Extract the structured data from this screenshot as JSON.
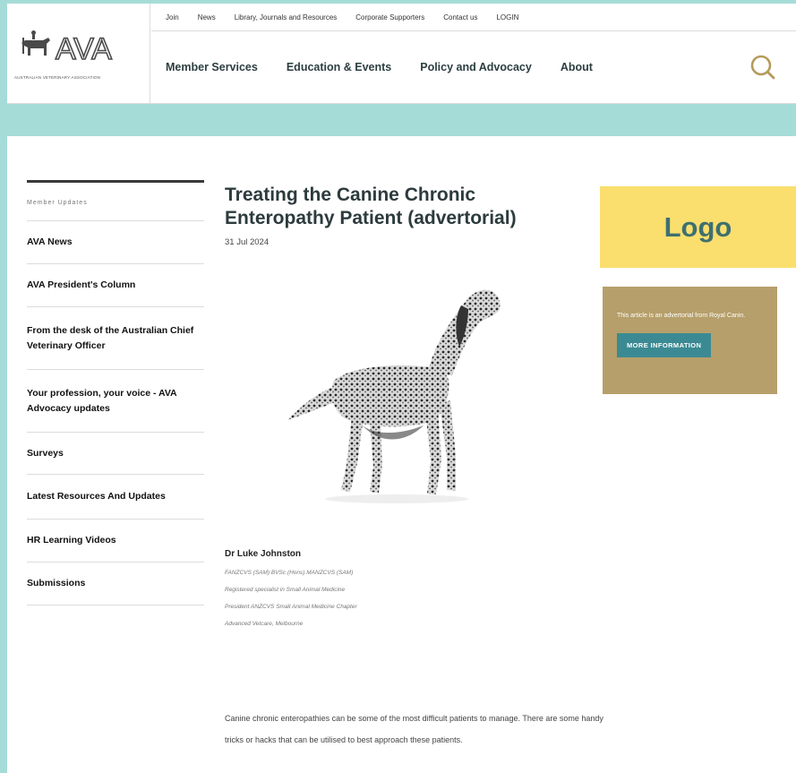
{
  "header": {
    "logo": {
      "wordmark": "AVA",
      "subtitle": "AUSTRALIAN VETERINARY ASSOCIATION"
    },
    "top_nav": [
      "Join",
      "News",
      "Library, Journals and Resources",
      "Corporate Supporters",
      "Contact us",
      "LOGIN"
    ],
    "main_nav": [
      "Member Services",
      "Education & Events",
      "Policy and Advocacy",
      "About"
    ],
    "search_icon": "search-icon"
  },
  "sidebar": {
    "section_label": "Member Updates",
    "items": [
      "AVA News",
      "AVA President's Column",
      "From the desk of the Australian Chief Veterinary Officer",
      "Your profession, your voice - AVA Advocacy updates",
      "Surveys",
      "Latest Resources And Updates",
      "HR Learning Videos",
      "Submissions"
    ]
  },
  "article": {
    "title": "Treating the Canine Chronic Enteropathy Patient (advertorial)",
    "date": "31 Jul 2024",
    "author": {
      "name": "Dr Luke Johnston",
      "credentials": [
        "FANZCVS (SAM) BVSc (Hons) MANZCVS (SAM)",
        "Registered specialist in Small Animal Medicine",
        "President ANZCVS Small Animal Medicine Chapter",
        "Advanced Vetcare, Melbourne"
      ]
    },
    "body": "Canine chronic enteropathies can be some of the most difficult patients to manage. There are some handy tricks or hacks that can be utilised to best approach these patients."
  },
  "aside": {
    "logo_placeholder": "Logo",
    "advertorial_note": "This article is an advertorial from Royal Canin.",
    "more_button": "MORE INFORMATION"
  },
  "colors": {
    "teal_band": "#a6dcd7",
    "logo_yellow": "#fadf6e",
    "advertorial_tan": "#b69f6a",
    "button_teal": "#3b8a93",
    "search_gold": "#b59a5c"
  }
}
